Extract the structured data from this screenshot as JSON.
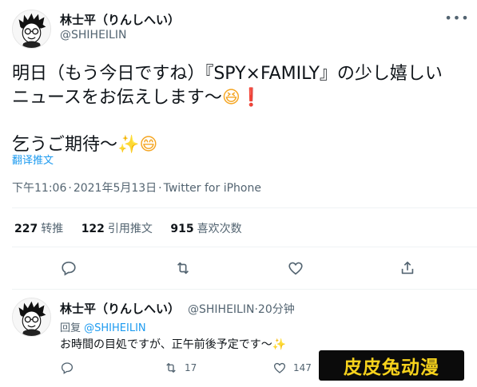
{
  "tweet": {
    "author": {
      "display_name": "林士平（りんしへい）",
      "handle": "@SHIHEILIN"
    },
    "more_icon": "more-dots-icon",
    "text_lines": [
      "明日（もう今日ですね）『SPY×FAMILY』の少し嬉しい",
      "ニュースをお伝えします〜",
      "乞うご期待〜"
    ],
    "emojis": {
      "laugh": "😆",
      "exclamation": "❗",
      "sparkles": "✨",
      "smile": "😄"
    },
    "translate_label": "翻译推文",
    "time": "下午11:06",
    "date": "2021年5月13日",
    "source": "Twitter for iPhone",
    "separator": "·",
    "stats": [
      {
        "count": "227",
        "label": "转推"
      },
      {
        "count": "122",
        "label": "引用推文"
      },
      {
        "count": "915",
        "label": "喜欢次数"
      }
    ],
    "actions": [
      "reply-icon",
      "retweet-icon",
      "like-icon",
      "share-icon"
    ]
  },
  "reply": {
    "author": {
      "display_name": "林士平（りんしへい）",
      "handle": "@SHIHEILIN",
      "time": "20分钟"
    },
    "reply_prefix": "回复",
    "reply_mention": "@SHIHEILIN",
    "text": "お時間の目処ですが、正午前後予定です〜",
    "emoji": "✨",
    "retweet_count": "17",
    "like_count": "147"
  },
  "watermark": {
    "text": "皮皮兔动漫"
  },
  "colors": {
    "accent": "#1d9bf0",
    "muted": "#536471",
    "text": "#0f1419",
    "watermark_text": "#f6d21c"
  }
}
